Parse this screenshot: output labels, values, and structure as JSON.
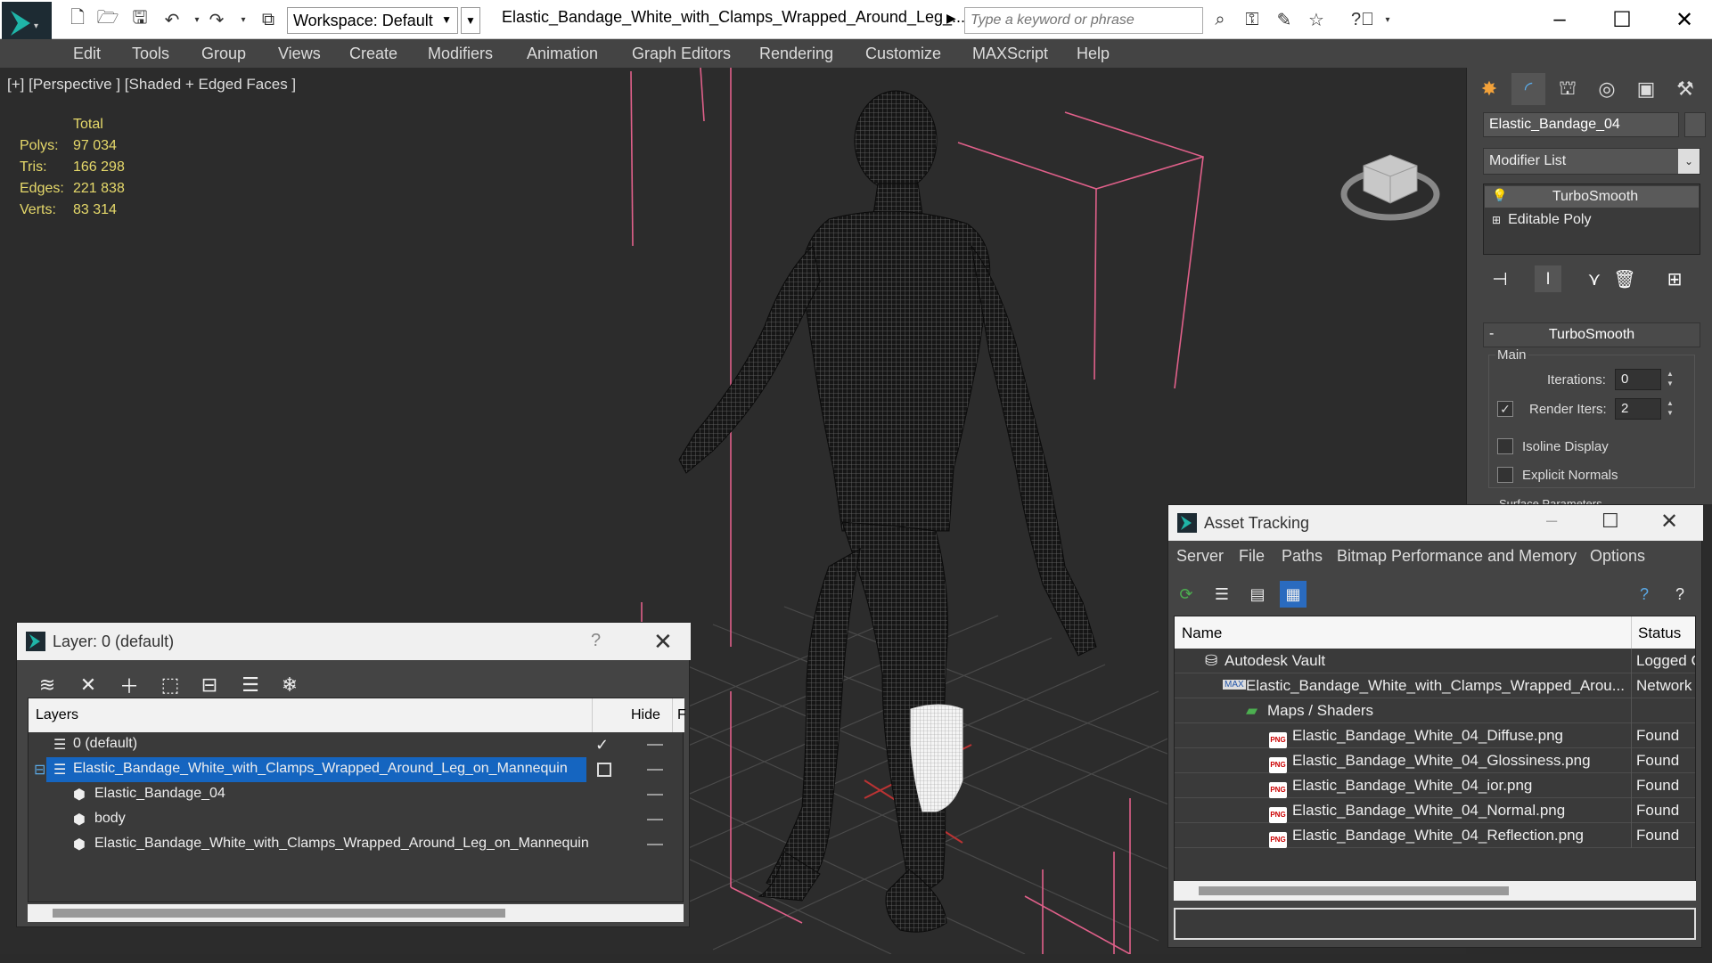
{
  "app": {
    "workspace": "Workspace: Default",
    "file_title": "Elastic_Bandage_White_with_Clamps_Wrapped_Around_Leg_...",
    "search_placeholder": "Type a keyword or phrase"
  },
  "menu": [
    "Edit",
    "Tools",
    "Group",
    "Views",
    "Create",
    "Modifiers",
    "Animation",
    "Graph Editors",
    "Rendering",
    "Customize",
    "MAXScript",
    "Help"
  ],
  "viewport": {
    "label": "[+] [Perspective ] [Shaded + Edged Faces ]",
    "stats": {
      "header": "Total",
      "rows": [
        {
          "label": "Polys:",
          "value": "97 034"
        },
        {
          "label": "Tris:",
          "value": "166 298"
        },
        {
          "label": "Edges:",
          "value": "221 838"
        },
        {
          "label": "Verts:",
          "value": "83 314"
        }
      ]
    }
  },
  "command_panel": {
    "object_name": "Elastic_Bandage_04",
    "modifier_list": "Modifier List",
    "stack": [
      "TurboSmooth",
      "Editable Poly"
    ],
    "rollout": {
      "title": "TurboSmooth",
      "group": "Main",
      "iterations_label": "Iterations:",
      "iterations_value": "0",
      "render_iters_label": "Render Iters:",
      "render_iters_value": "2",
      "isoline_label": "Isoline Display",
      "explicit_label": "Explicit Normals",
      "surface_label": "Surface Parameters"
    }
  },
  "layer_dialog": {
    "title": "Layer: 0 (default)",
    "help": "?",
    "col_layers": "Layers",
    "col_hide": "Hide",
    "col_f": "F",
    "rows": [
      {
        "name": "0 (default)"
      },
      {
        "name": "Elastic_Bandage_White_with_Clamps_Wrapped_Around_Leg_on_Mannequin"
      },
      {
        "name": "Elastic_Bandage_04"
      },
      {
        "name": "body"
      },
      {
        "name": "Elastic_Bandage_White_with_Clamps_Wrapped_Around_Leg_on_Mannequin"
      }
    ]
  },
  "asset_dialog": {
    "title": "Asset Tracking",
    "menu": [
      "Server",
      "File",
      "Paths",
      "Bitmap Performance and Memory",
      "Options"
    ],
    "col_name": "Name",
    "col_status": "Status",
    "rows": [
      {
        "name": "Autodesk Vault",
        "status": "Logged C"
      },
      {
        "name": "Elastic_Bandage_White_with_Clamps_Wrapped_Arou...",
        "status": "Network"
      },
      {
        "name": "Maps / Shaders",
        "status": ""
      },
      {
        "name": "Elastic_Bandage_White_04_Diffuse.png",
        "status": "Found"
      },
      {
        "name": "Elastic_Bandage_White_04_Glossiness.png",
        "status": "Found"
      },
      {
        "name": "Elastic_Bandage_White_04_ior.png",
        "status": "Found"
      },
      {
        "name": "Elastic_Bandage_White_04_Normal.png",
        "status": "Found"
      },
      {
        "name": "Elastic_Bandage_White_04_Reflection.png",
        "status": "Found"
      }
    ]
  }
}
